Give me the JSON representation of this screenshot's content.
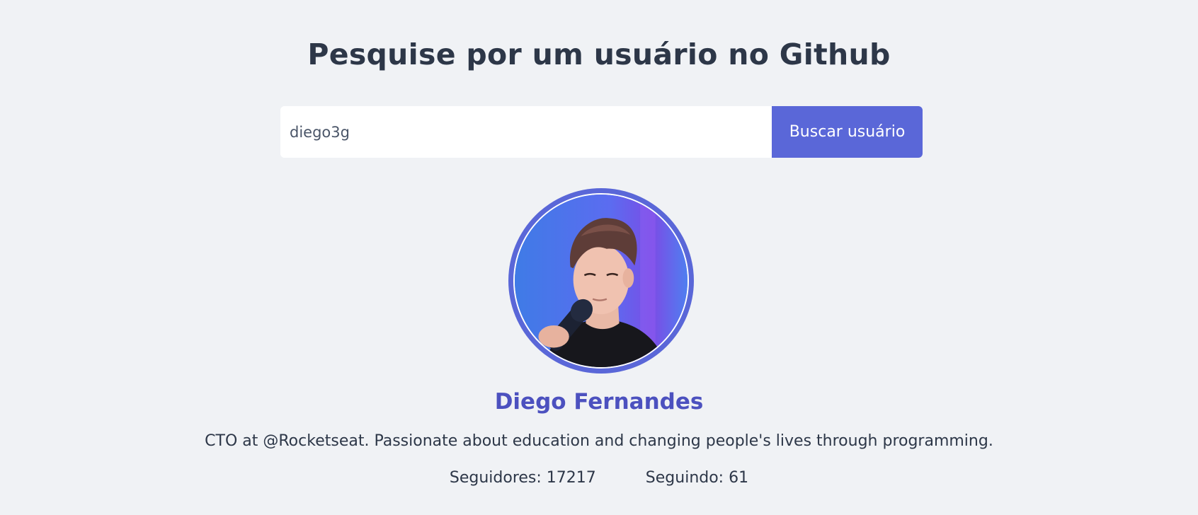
{
  "header": {
    "title": "Pesquise por um usuário no Github"
  },
  "search": {
    "value": "diego3g",
    "button_label": "Buscar usuário"
  },
  "profile": {
    "name": "Diego Fernandes",
    "bio": "CTO at @Rocketseat. Passionate about education and changing people's lives through programming.",
    "followers_label": "Seguidores:",
    "followers_count": "17217",
    "following_label": "Seguindo:",
    "following_count": "61"
  },
  "colors": {
    "background": "#f0f2f5",
    "accent": "#5a67d8",
    "name": "#4c51bf",
    "text": "#2d3748"
  }
}
